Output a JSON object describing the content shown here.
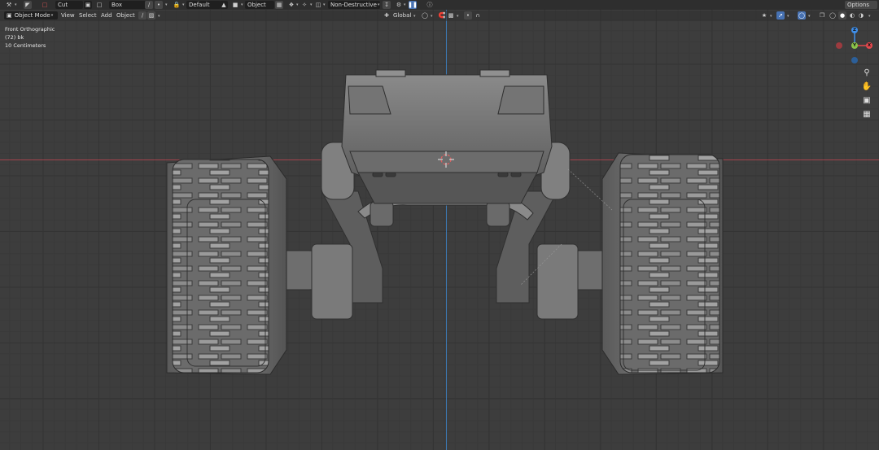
{
  "tool_header": {
    "cut_label": "Cut",
    "box_label": "Box",
    "default_label": "Default",
    "object_label": "Object",
    "mode_label": "Non-Destructive",
    "options_label": "Options"
  },
  "view_header": {
    "mode": "Object Mode",
    "menu": [
      "View",
      "Select",
      "Add",
      "Object"
    ],
    "transform_orientation": "Global"
  },
  "overlay": {
    "view_name": "Front Orthographic",
    "collection": "(72) bk",
    "scale": "10 Centimeters"
  },
  "gizmo": {
    "z": "Z",
    "y": "Y",
    "x": "X",
    "colors": {
      "x": "#e5484d",
      "y": "#8bc34a",
      "z": "#3f8ee8"
    }
  },
  "icons": [
    "hammer-icon",
    "select-icon",
    "cut-icon",
    "box-icon",
    "lock-icon",
    "snap-icon",
    "proportional-icon",
    "gear-icon",
    "pause-icon",
    "help-icon",
    "zoom-icon",
    "hand-icon",
    "camera-icon",
    "grid-icon"
  ]
}
